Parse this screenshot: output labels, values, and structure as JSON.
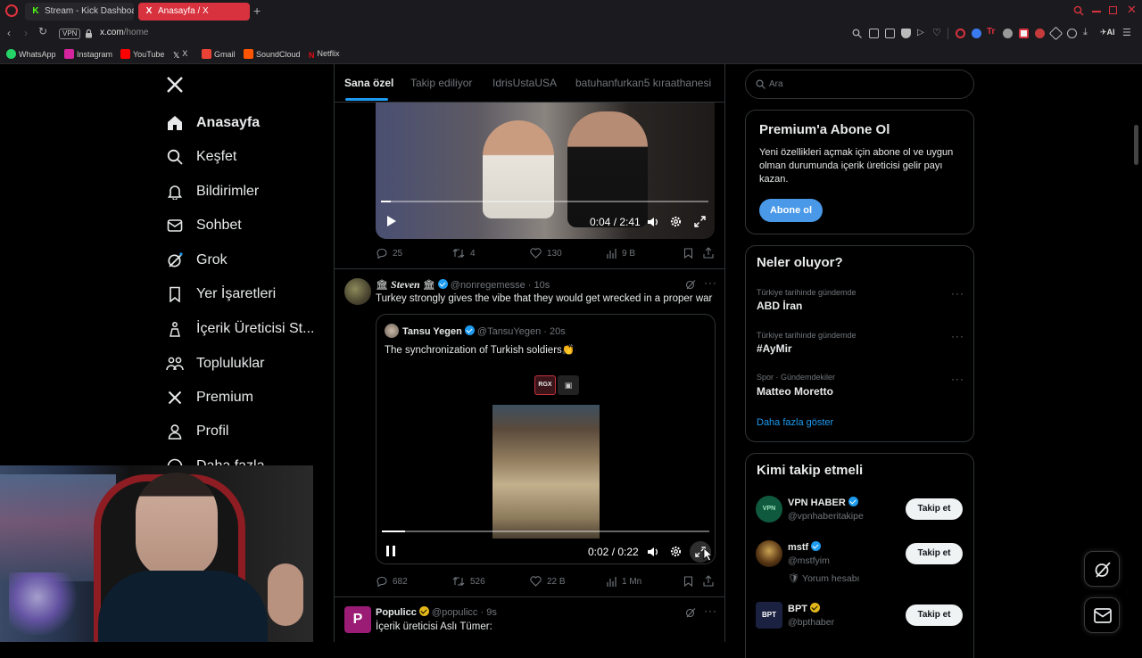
{
  "browser": {
    "tabs": [
      {
        "label": "Stream - Kick Dashboa",
        "favicon": "K"
      },
      {
        "label": "Anasayfa / X",
        "favicon": "X"
      }
    ],
    "vpn_label": "VPN",
    "url_host": "x.com",
    "url_path": "/home",
    "ai_label": "AI",
    "bookmarks": [
      {
        "label": "WhatsApp",
        "color": "#25d366"
      },
      {
        "label": "Instagram",
        "color": "#d6249f"
      },
      {
        "label": "YouTube",
        "color": "#ff0000"
      },
      {
        "label": "X",
        "color": "#ffffff"
      },
      {
        "label": "Gmail",
        "color": "#ea4335"
      },
      {
        "label": "SoundCloud",
        "color": "#ff5500"
      },
      {
        "label": "Netflix",
        "color": "#e50914"
      }
    ]
  },
  "sidebar": {
    "items": [
      {
        "label": "Anasayfa",
        "icon": "home-icon"
      },
      {
        "label": "Keşfet",
        "icon": "search-icon"
      },
      {
        "label": "Bildirimler",
        "icon": "bell-icon"
      },
      {
        "label": "Sohbet",
        "icon": "mail-icon"
      },
      {
        "label": "Grok",
        "icon": "grok-icon"
      },
      {
        "label": "Yer İşaretleri",
        "icon": "bookmark-icon"
      },
      {
        "label": "İçerik Üreticisi St...",
        "icon": "creator-icon"
      },
      {
        "label": "Topluluklar",
        "icon": "communities-icon"
      },
      {
        "label": "Premium",
        "icon": "x-logo-icon"
      },
      {
        "label": "Profil",
        "icon": "person-icon"
      },
      {
        "label": "Daha fazla",
        "icon": "more-icon"
      }
    ]
  },
  "timeline": {
    "tabs": [
      "Sana özel",
      "Takip ediliyor",
      "IdrisUstaUSA",
      "batuhanfurkan5 kıraathanesi"
    ],
    "posts": [
      {
        "video": {
          "time": "0:04 / 2:41",
          "progress": 0.03
        },
        "stats": {
          "replies": "25",
          "reposts": "4",
          "likes": "130",
          "views": "9 B"
        }
      },
      {
        "author": "Steven",
        "author_emoji": "🏛",
        "handle": "@nonregemesse",
        "time": "· 10s",
        "text": "Turkey strongly gives the vibe that they would get wrecked in a proper war",
        "quote": {
          "author": "Tansu Yegen",
          "handle": "@TansuYegen",
          "time": "· 20s",
          "text": "The synchronization of Turkish soldiers👏",
          "badge": "RGX"
        },
        "video": {
          "time": "0:02 / 0:22",
          "progress": 0.07
        },
        "stats": {
          "replies": "682",
          "reposts": "526",
          "likes": "22 B",
          "views": "1 Mn"
        }
      },
      {
        "author": "Populicc",
        "handle": "@populicc",
        "time": "· 9s",
        "text": "İçerik üreticisi Aslı Tümer:"
      }
    ]
  },
  "right": {
    "search_placeholder": "Ara",
    "premium": {
      "title": "Premium'a Abone Ol",
      "body": "Yeni özellikleri açmak için abone ol ve uygun olman durumunda içerik üreticisi gelir payı kazan.",
      "button": "Abone ol"
    },
    "trends": {
      "title": "Neler oluyor?",
      "items": [
        {
          "context": "Türkiye tarihinde gündemde",
          "title": "ABD İran"
        },
        {
          "context": "Türkiye tarihinde gündemde",
          "title": "#AyMir"
        },
        {
          "context": "Spor · Gündemdekiler",
          "title": "Matteo Moretto"
        }
      ],
      "show_more": "Daha fazla göster"
    },
    "who_to_follow": {
      "title": "Kimi takip etmeli",
      "accounts": [
        {
          "name": "VPN HABER",
          "handle": "@vpnhaberitakipe",
          "note": "",
          "avatar_text": "VPN"
        },
        {
          "name": "mstf",
          "handle": "@mstfyim",
          "note": "🛡 Yorum hesabı",
          "avatar_text": ""
        },
        {
          "name": "BPT",
          "handle": "@bpthaber",
          "note": "",
          "avatar_text": "BPT"
        }
      ],
      "follow_label": "Takip et"
    }
  },
  "colors": {
    "accent": "#1d9bf0",
    "premium_button": "#4a99e9",
    "opera_red": "#e0313c"
  }
}
